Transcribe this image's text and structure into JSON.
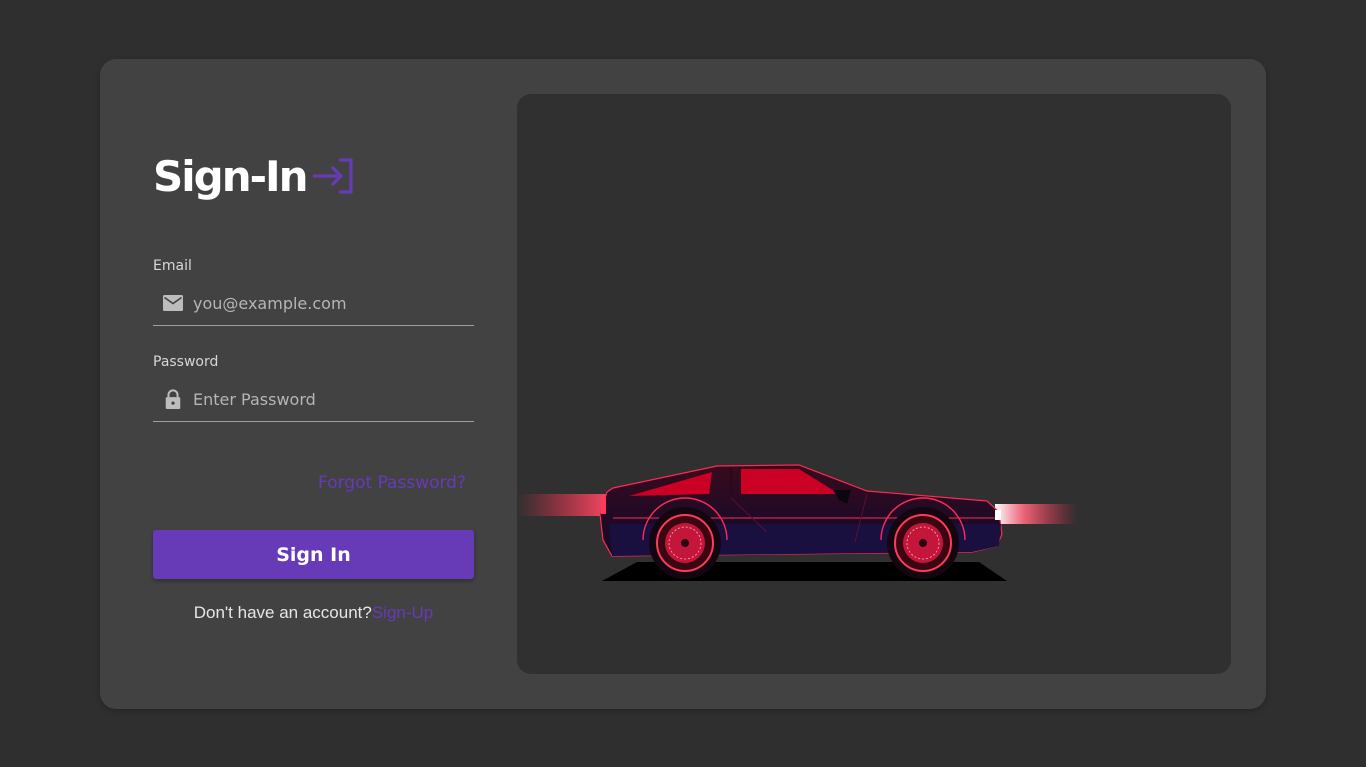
{
  "signin": {
    "title": "Sign-In",
    "email_label": "Email",
    "email_placeholder": "you@example.com",
    "password_label": "Password",
    "password_placeholder": "Enter Password",
    "forgot_password": "Forgot Password?",
    "signin_button": "Sign In",
    "no_account_text": "Don't have an account?",
    "signup_link": "Sign-Up"
  },
  "colors": {
    "accent": "#673ab7",
    "background": "#2f2f2f",
    "card": "#424242",
    "hero_panel": "#303030",
    "car_red": "#e8002a"
  },
  "icons": {
    "title": "login-arrow-icon",
    "email": "mail-icon",
    "password": "lock-icon"
  },
  "hero": {
    "image": "sports-car-illustration"
  }
}
